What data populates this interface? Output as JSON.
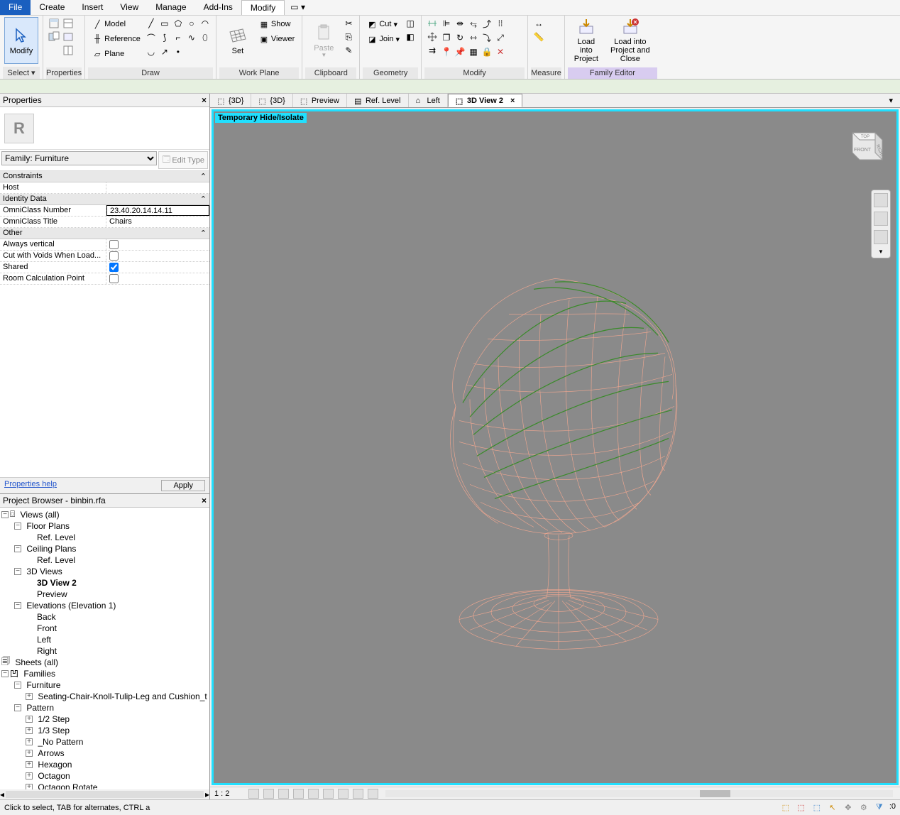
{
  "menu": {
    "items": [
      "File",
      "Create",
      "Insert",
      "View",
      "Manage",
      "Add-Ins",
      "Modify"
    ],
    "active": "Modify"
  },
  "ribbon": {
    "select": {
      "modify": "Modify",
      "select": "Select"
    },
    "properties": "Properties",
    "draw": {
      "label": "Draw",
      "model": "Model",
      "reference": "Reference",
      "plane": "Plane"
    },
    "workplane": {
      "label": "Work Plane",
      "set": "Set",
      "show": "Show",
      "viewer": "Viewer"
    },
    "clipboard": {
      "label": "Clipboard",
      "paste": "Paste"
    },
    "geometry": {
      "label": "Geometry",
      "cut": "Cut",
      "join": "Join"
    },
    "modify": {
      "label": "Modify"
    },
    "measure": {
      "label": "Measure"
    },
    "load1": {
      "l1": "Load into",
      "l2": "Project"
    },
    "load2": {
      "l1": "Load into",
      "l2": "Project and Close"
    },
    "family": "Family Editor"
  },
  "properties": {
    "title": "Properties",
    "family": "Family: Furniture",
    "editType": "Edit Type",
    "groups": {
      "constraints": "Constraints",
      "identity": "Identity Data",
      "other": "Other"
    },
    "rows": {
      "host": {
        "k": "Host",
        "v": ""
      },
      "omniNum": {
        "k": "OmniClass Number",
        "v": "23.40.20.14.14.11"
      },
      "omniTitle": {
        "k": "OmniClass Title",
        "v": "Chairs"
      },
      "alwaysVert": {
        "k": "Always vertical"
      },
      "cutVoids": {
        "k": "Cut with Voids When Load..."
      },
      "shared": {
        "k": "Shared"
      },
      "roomCalc": {
        "k": "Room Calculation Point"
      }
    },
    "help": "Properties help",
    "apply": "Apply"
  },
  "browser": {
    "title": "Project Browser - binbin.rfa",
    "nodes": {
      "views": "Views (all)",
      "floorPlans": "Floor Plans",
      "refLevel": "Ref. Level",
      "ceilingPlans": "Ceiling Plans",
      "3dViews": "3D Views",
      "3dView2": "3D View 2",
      "preview": "Preview",
      "elevations": "Elevations (Elevation 1)",
      "back": "Back",
      "front": "Front",
      "left": "Left",
      "right": "Right",
      "sheets": "Sheets (all)",
      "families": "Families",
      "furniture": "Furniture",
      "seating": "Seating-Chair-Knoll-Tulip-Leg and Cushion_t",
      "pattern": "Pattern",
      "half": "1/2 Step",
      "third": "1/3 Step",
      "nopat": "_No Pattern",
      "arrows": "Arrows",
      "hexagon": "Hexagon",
      "octagon": "Octagon",
      "octRot": "Octagon Rotate"
    }
  },
  "tabs": [
    {
      "label": "{3D}",
      "active": false
    },
    {
      "label": "{3D}",
      "active": false
    },
    {
      "label": "Preview",
      "active": false
    },
    {
      "label": "Ref. Level",
      "active": false
    },
    {
      "label": "Left",
      "active": false
    },
    {
      "label": "3D View 2",
      "active": true
    }
  ],
  "viewport": {
    "badge": "Temporary Hide/Isolate",
    "scale": "1 : 2",
    "cube": {
      "top": "TOP",
      "front": "FRONT",
      "right": "RIGHT"
    }
  },
  "status": {
    "hint": "Click to select, TAB for alternates, CTRL a",
    "filter": ":0"
  }
}
